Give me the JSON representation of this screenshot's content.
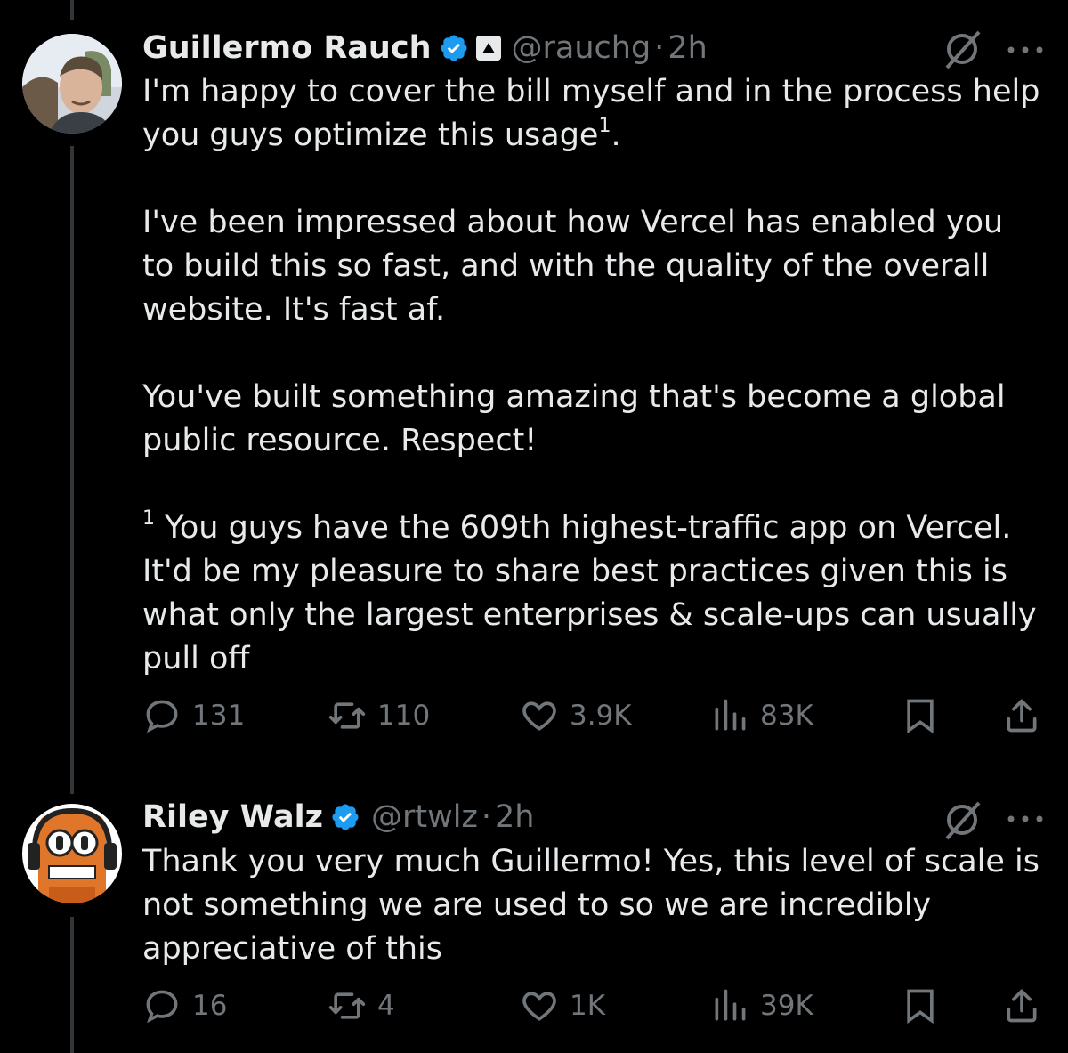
{
  "tweets": [
    {
      "author_name": "Guillermo Rauch",
      "handle": "@rauchg",
      "separator": "·",
      "time": "2h",
      "text": {
        "p1": "I'm happy to cover the bill myself and in the process help you guys optimize this usage",
        "p1_sup": "1",
        "p1_end": ".",
        "p2": "I've been impressed about how Vercel has enabled you to build this so fast, and with the quality of the overall website. It's fast af.",
        "p3": "You've built something amazing that's become a global public resource. Respect!",
        "p4_sup": "1",
        "p4": " You guys have the 609th highest-traffic app on Vercel. It'd be my pleasure to share best practices given this is what only the largest enterprises & scale-ups can usually pull off"
      },
      "stats": {
        "replies": "131",
        "reposts": "110",
        "likes": "3.9K",
        "views": "83K"
      }
    },
    {
      "author_name": "Riley Walz",
      "handle": "@rtwlz",
      "separator": "·",
      "time": "2h",
      "text": {
        "p1": "Thank you very much Guillermo! Yes, this level of scale is not something we are used to so we are incredibly appreciative of this"
      },
      "stats": {
        "replies": "16",
        "reposts": "4",
        "likes": "1K",
        "views": "39K"
      }
    }
  ],
  "icons": {
    "verified": "verified-badge-icon",
    "affiliate": "triangle-up-icon",
    "grok": "grok-icon",
    "more": "more-horizontal-icon",
    "reply": "reply-icon",
    "repost": "repost-icon",
    "like": "heart-icon",
    "views": "views-icon",
    "bookmark": "bookmark-icon",
    "share": "share-icon"
  },
  "colors": {
    "background": "#000000",
    "text": "#e7e9ea",
    "muted": "#71767b",
    "verified": "#1d9bf0"
  }
}
